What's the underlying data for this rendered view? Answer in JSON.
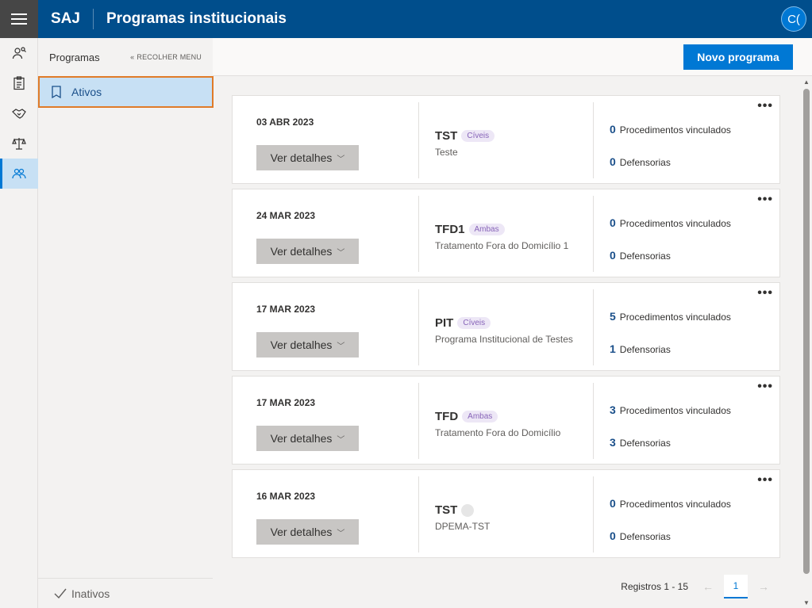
{
  "header": {
    "brand": "SAJ",
    "title": "Programas institucionais",
    "avatar": "C("
  },
  "rail": [
    {
      "icon": "person-search-icon"
    },
    {
      "icon": "clipboard-icon"
    },
    {
      "icon": "handshake-icon"
    },
    {
      "icon": "scales-icon"
    },
    {
      "icon": "people-icon",
      "active": true
    }
  ],
  "panel": {
    "title": "Programas",
    "collapse_label": "RECOLHER MENU",
    "active_item": "Ativos",
    "footer_item": "Inativos"
  },
  "toolbar": {
    "new_button": "Novo programa"
  },
  "programs": [
    {
      "date": "03 ABR 2023",
      "code": "TST",
      "tag": "Cíveis",
      "desc": "Teste",
      "proc": "0",
      "def": "0"
    },
    {
      "date": "24 MAR 2023",
      "code": "TFD1",
      "tag": "Ambas",
      "desc": "Tratamento Fora do Domicílio 1",
      "proc": "0",
      "def": "0"
    },
    {
      "date": "17 MAR 2023",
      "code": "PIT",
      "tag": "Cíveis",
      "desc": "Programa Institucional de Testes",
      "proc": "5",
      "def": "1"
    },
    {
      "date": "17 MAR 2023",
      "code": "TFD",
      "tag": "Ambas",
      "desc": "Tratamento Fora do Domicílio",
      "proc": "3",
      "def": "3"
    },
    {
      "date": "16 MAR 2023",
      "code": "TST",
      "tag": "",
      "desc": "DPEMA-TST",
      "proc": "0",
      "def": "0"
    }
  ],
  "labels": {
    "details": "Ver detalhes",
    "proc": "Procedimentos vinculados",
    "def": "Defensorias"
  },
  "pager": {
    "count": "Registros 1 - 15",
    "page": "1"
  }
}
